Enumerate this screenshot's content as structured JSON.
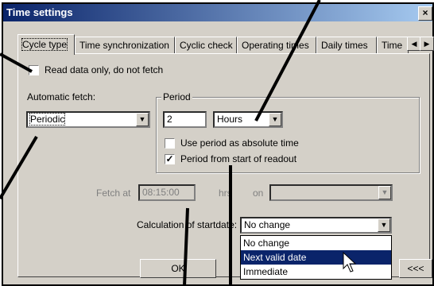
{
  "window": {
    "title": "Time settings",
    "close_glyph": "×"
  },
  "tabs": [
    {
      "label": "Cycle type",
      "active": true
    },
    {
      "label": "Time synchronization"
    },
    {
      "label": "Cyclic check"
    },
    {
      "label": "Operating times"
    },
    {
      "label": "Daily times"
    },
    {
      "label": "Time"
    }
  ],
  "tab_scroll": {
    "left": "◀",
    "right": "▶"
  },
  "read_only": {
    "label": "Read data only, do not fetch",
    "checked": false
  },
  "auto_fetch": {
    "label": "Automatic fetch:",
    "value": "Periodic"
  },
  "period": {
    "group_label": "Period",
    "value": "2",
    "unit": "Hours",
    "absolute_label": "Use period as absolute time",
    "absolute_checked": false,
    "from_start_label": "Period from start of readout",
    "from_start_checked": true
  },
  "fetch_at": {
    "label": "Fetch at",
    "value": "08:15:00",
    "unit": "hrs",
    "on_label": "on",
    "on_value": ""
  },
  "start_date": {
    "label": "Calculation of startdate:",
    "value": "No change",
    "options": [
      "No change",
      "Next valid date",
      "Immediate"
    ],
    "highlighted": "Next valid date"
  },
  "buttons": {
    "ok": "OK",
    "more": "<<<"
  },
  "dropdown_arrow": "▼",
  "check_glyph": "✓"
}
